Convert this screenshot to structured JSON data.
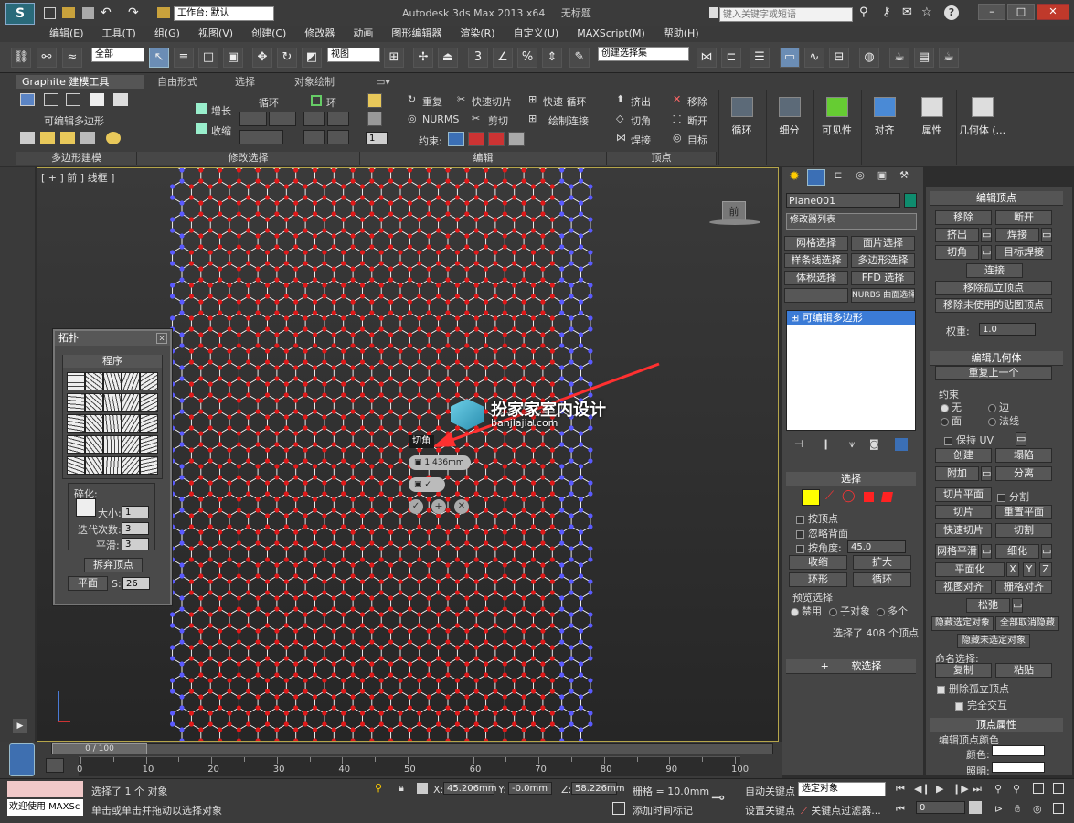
{
  "window": {
    "title": "Autodesk 3ds Max  2013 x64",
    "file": "无标题",
    "workspace_label": "工作台: 默认",
    "search_placeholder": "键入关键字或短语"
  },
  "menu": [
    "编辑(E)",
    "工具(T)",
    "组(G)",
    "视图(V)",
    "创建(C)",
    "修改器",
    "动画",
    "图形编辑器",
    "渲染(R)",
    "自定义(U)",
    "MAXScript(M)",
    "帮助(H)"
  ],
  "toolbar": {
    "filter_value": "全部",
    "ref_coord": "视图",
    "named_selection": "创建选择集"
  },
  "ribbon": {
    "tabs": [
      "Graphite 建模工具",
      "自由形式",
      "选择",
      "对象绘制"
    ],
    "poly_label": "可编辑多边形",
    "grow": "增长",
    "shrink": "收缩",
    "loop": "循环",
    "ring": "环",
    "repeat": "重复",
    "nurms": "NURMS",
    "quickslice": "快速切片",
    "cut": "剪切",
    "quickloop": "快速 循环",
    "paintconnect": "绘制连接",
    "constraint": "约束:",
    "extrude": "挤出",
    "chamfer": "切角",
    "weld": "焊接",
    "remove": "移除",
    "break": "断开",
    "target": "目标",
    "spin_value": "1",
    "big": [
      "循环",
      "细分",
      "可见性",
      "对齐",
      "属性",
      "几何体 (..."
    ],
    "footers": [
      "多边形建模",
      "修改选择",
      "编辑",
      "顶点"
    ]
  },
  "viewport": {
    "label": "[ + ] 前 ] 线框 ]",
    "viewcube_label": "前",
    "watermark_title": "扮家家室内设计",
    "watermark_url": "banjiajia.com",
    "caddy_title": "切角",
    "caddy_value": "1.436mm"
  },
  "topology": {
    "title": "拓扑",
    "group": "程序",
    "fragment": "碎化:",
    "size_label": "大小:",
    "size_val": "1",
    "iter_label": "迭代次数:",
    "iter_val": "3",
    "smooth_label": "平滑:",
    "smooth_val": "3",
    "discard": "拆弃顶点",
    "plane": "平面",
    "s_label": "S:",
    "s_val": "26",
    "close": "x"
  },
  "command_panel": {
    "object_name": "Plane001",
    "modifier_list": "修改器列表",
    "mod_buttons": [
      "网格选择",
      "面片选择",
      "样条线选择",
      "多边形选择",
      "体积选择",
      "FFD 选择",
      "",
      "NURBS 曲面选择"
    ],
    "stack_item": "可编辑多边形",
    "selection_title": "选择",
    "by_vertex": "按顶点",
    "ignore_back": "忽略背面",
    "by_angle": "按角度:",
    "angle_val": "45.0",
    "shrink": "收缩",
    "grow": "扩大",
    "ring": "环形",
    "loop": "循环",
    "preview": "预览选择",
    "disabled": "禁用",
    "subobj": "子对象",
    "multi": "多个",
    "sel_count": "选择了 408 个顶点",
    "soft_sel": "软选择"
  },
  "edit_vertices": {
    "title": "编辑顶点",
    "remove": "移除",
    "break": "断开",
    "extrude": "挤出",
    "weld": "焊接",
    "chamfer": "切角",
    "target_weld": "目标焊接",
    "connect": "连接",
    "remove_iso": "移除孤立顶点",
    "remove_unused": "移除未使用的贴图顶点",
    "weight_label": "权重:",
    "weight_val": "1.0"
  },
  "edit_geometry": {
    "title": "编辑几何体",
    "repeat_last": "重复上一个",
    "constraints": "约束",
    "none": "无",
    "edge": "边",
    "face": "面",
    "normal": "法线",
    "preserve_uv": "保持 UV",
    "create": "创建",
    "collapse": "塌陷",
    "attach": "附加",
    "detach": "分离",
    "slice_plane": "切片平面",
    "split": "分割",
    "slice": "切片",
    "reset_plane": "重置平面",
    "quickslice": "快速切片",
    "cut": "切割",
    "mesh_smooth": "网格平滑",
    "tessellate": "细化",
    "make_planar": "平面化",
    "x": "X",
    "y": "Y",
    "z": "Z",
    "view_align": "视图对齐",
    "grid_align": "栅格对齐",
    "relax": "松弛",
    "hide_sel": "隐藏选定对象",
    "unhide_all": "全部取消隐藏",
    "hide_unsel": "隐藏未选定对象",
    "named_sel": "命名选择:",
    "copy": "复制",
    "paste": "粘贴",
    "delete_iso": "删除孤立顶点",
    "full_interactivity": "完全交互"
  },
  "vertex_props": {
    "title": "顶点属性",
    "color_group": "编辑顶点颜色",
    "color": "颜色:",
    "illum": "照明:"
  },
  "timeline": {
    "frame": "0 / 100",
    "ticks": [
      "0",
      "10",
      "20",
      "30",
      "40",
      "50",
      "60",
      "70",
      "80",
      "90",
      "100"
    ]
  },
  "status": {
    "welcome": "欢迎使用 MAXSc",
    "line1": "选择了 1 个 对象",
    "line2": "单击或单击并拖动以选择对象",
    "x_label": "X:",
    "x_val": "45.206mm",
    "y_label": "Y:",
    "y_val": "-0.0mm",
    "z_label": "Z:",
    "z_val": "58.226mm",
    "grid": "栅格 = 10.0mm",
    "autokey": "自动关键点",
    "selected": "选定对象",
    "setkey": "设置关键点",
    "keyfilter": "关键点过滤器...",
    "add_time_tag": "添加时间标记",
    "frame_val": "0"
  },
  "colors": {
    "vertex": "#e01a1a",
    "edge": "#ffffff",
    "border_vertex": "#5a5aff",
    "viewport_border": "#b5a54a",
    "active_stack": "#3b7bd6"
  }
}
